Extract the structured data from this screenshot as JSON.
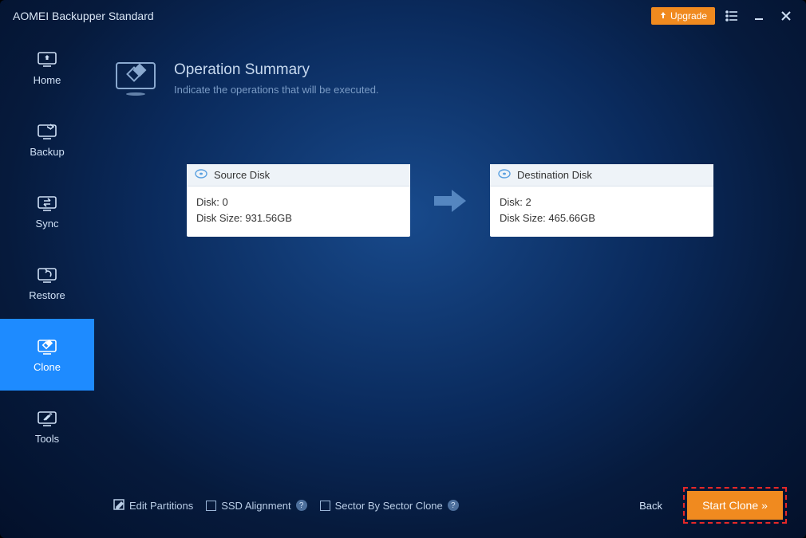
{
  "titlebar": {
    "app_title": "AOMEI Backupper Standard",
    "upgrade_label": "Upgrade"
  },
  "sidebar": {
    "items": [
      {
        "label": "Home"
      },
      {
        "label": "Backup"
      },
      {
        "label": "Sync"
      },
      {
        "label": "Restore"
      },
      {
        "label": "Clone"
      },
      {
        "label": "Tools"
      }
    ],
    "active_index": 4
  },
  "header": {
    "title": "Operation Summary",
    "subtitle": "Indicate the operations that will be executed."
  },
  "source": {
    "header": "Source Disk",
    "line1": "Disk: 0",
    "line2": "Disk Size: 931.56GB"
  },
  "destination": {
    "header": "Destination Disk",
    "line1": "Disk: 2",
    "line2": "Disk Size: 465.66GB"
  },
  "footer": {
    "edit_partitions": "Edit Partitions",
    "ssd_alignment": "SSD Alignment",
    "sector_by_sector": "Sector By Sector Clone",
    "back": "Back",
    "start_clone": "Start Clone"
  }
}
